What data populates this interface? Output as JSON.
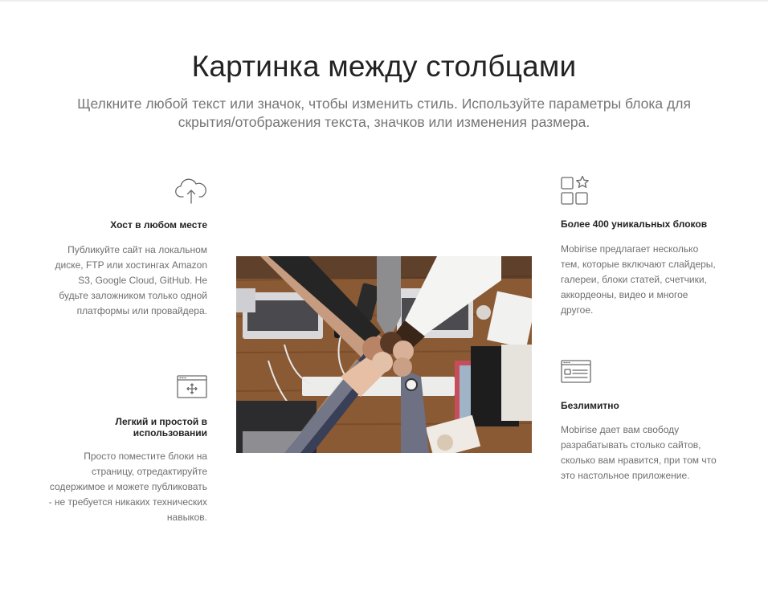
{
  "header": {
    "title": "Картинка между столбцами",
    "subtitle": "Щелкните любой текст или значок, чтобы изменить стиль. Используйте параметры блока для скрытия/отображения текста, значков или изменения размера."
  },
  "features": [
    {
      "icon": "cloud-upload-icon",
      "title": "Хост в любом месте",
      "text": "Публикуйте сайт на локальном диске, FTP или хостингах Amazon S3, Google Cloud, GitHub. Не будьте заложником только одной платформы или провайдера."
    },
    {
      "icon": "browser-move-icon",
      "title": "Легкий и простой в использовании",
      "text": "Просто поместите блоки на страницу, отредактируйте содержимое и можете публиковать - не требуется никаких технических навыков."
    },
    {
      "icon": "blocks-star-icon",
      "title": "Более 400 уникальных блоков",
      "text": "Mobirise предлагает несколько тем, которые включают слайдеры, галереи, блоки статей, счетчики, аккордеоны, видео и многое другое."
    },
    {
      "icon": "browser-window-icon",
      "title": "Безлимитно",
      "text": "Mobirise дает вам свободу разрабатывать столько сайтов, сколько вам нравится, при том что это настольное приложение."
    }
  ],
  "image": {
    "subject": "team-fist-bump-photo"
  },
  "colors": {
    "heading": "#232323",
    "body_text": "#6f6f6f",
    "subtitle": "#767676",
    "icon": "#6a6a6a",
    "background": "#ffffff"
  }
}
